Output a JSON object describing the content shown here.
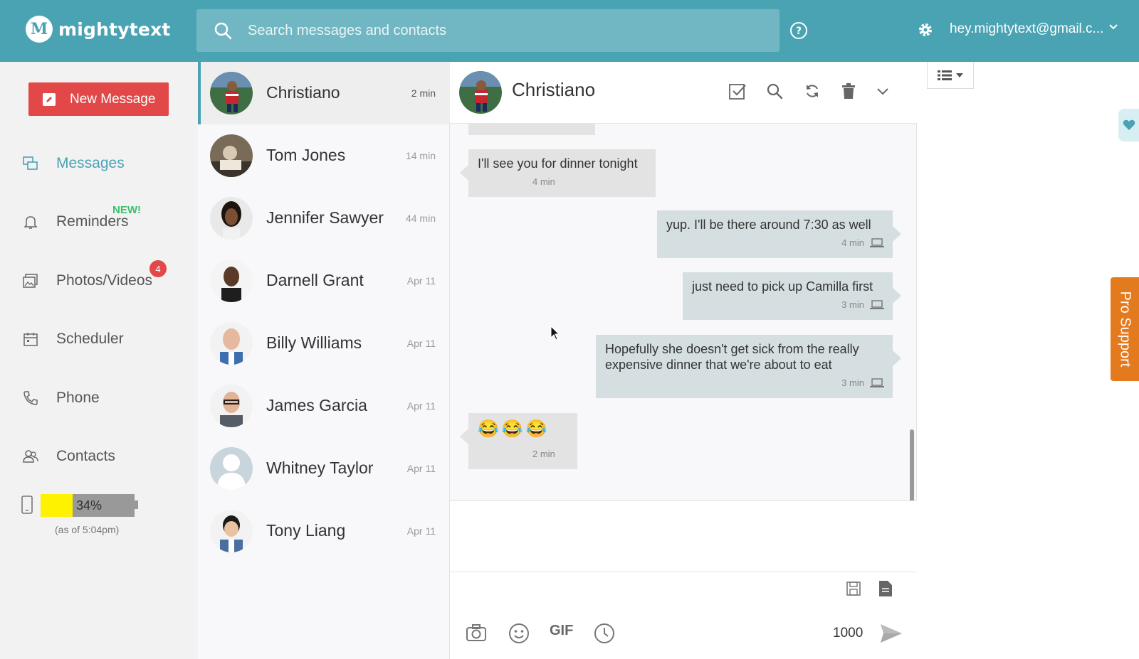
{
  "app": {
    "logo_mark": "M",
    "logo_text": "mightytext",
    "account": "hey.mightytext@gmail.c..."
  },
  "search": {
    "placeholder": "Search messages and contacts"
  },
  "sidebar": {
    "new_message": "New Message",
    "items": [
      {
        "label": "Messages"
      },
      {
        "label": "Reminders"
      },
      {
        "label": "Photos/Videos"
      },
      {
        "label": "Scheduler"
      },
      {
        "label": "Phone"
      },
      {
        "label": "Contacts"
      }
    ],
    "new_badge": "NEW!",
    "photos_count": "4",
    "battery": {
      "percent_text": "34%",
      "level": 0.34,
      "as_of": "(as of 5:04pm)"
    }
  },
  "conversations": [
    {
      "name": "Christiano",
      "time": "2 min"
    },
    {
      "name": "Tom Jones",
      "time": "14 min"
    },
    {
      "name": "Jennifer Sawyer",
      "time": "44 min"
    },
    {
      "name": "Darnell Grant",
      "time": "Apr 11"
    },
    {
      "name": "Billy Williams",
      "time": "Apr 11"
    },
    {
      "name": "James Garcia",
      "time": "Apr 11"
    },
    {
      "name": "Whitney Taylor",
      "time": "Apr 11"
    },
    {
      "name": "Tony Liang",
      "time": "Apr 11"
    }
  ],
  "chat": {
    "title": "Christiano",
    "messages": [
      {
        "text": "I'll see you for dinner tonight",
        "time": "4 min"
      },
      {
        "text": "yup. I'll be there around 7:30 as well",
        "time": "4 min"
      },
      {
        "text": "just need to pick up Camilla first",
        "time": "3 min"
      },
      {
        "line1": "Hopefully she doesn't get sick from the really",
        "line2": "expensive dinner that we're about to eat",
        "time": "3 min"
      },
      {
        "text": "😂😂😂",
        "time": "2 min"
      }
    ],
    "compose": {
      "gif_label": "GIF",
      "char_count": "1000"
    }
  },
  "right_panel": {
    "pro_support": "Pro Support"
  },
  "colors": {
    "brand": "#4aa3b3",
    "accent_red": "#e34848",
    "new_green": "#3ac06d",
    "pro_orange": "#e47a1e"
  }
}
